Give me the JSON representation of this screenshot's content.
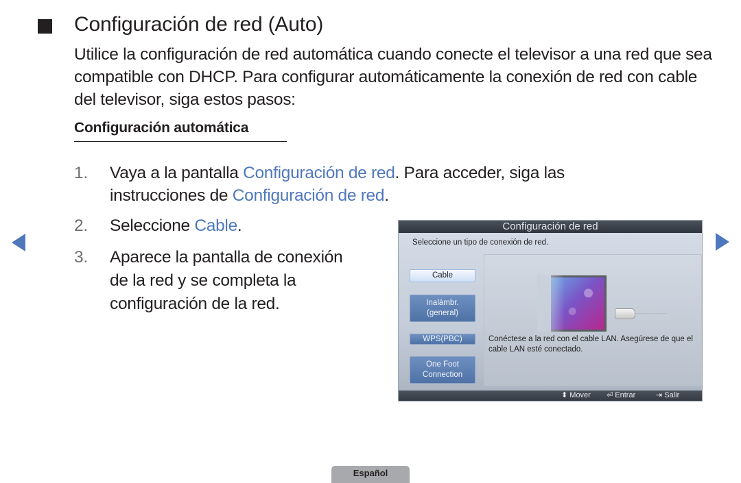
{
  "page": {
    "title": "Configuración de red (Auto)",
    "intro": "Utilice la configuración de red automática cuando conecte el televisor a una red que sea compatible con DHCP. Para configurar automáticamente la conexión de red con cable del televisor, siga estos pasos:",
    "subheading": "Configuración automática",
    "accent_color": "#4f78bc"
  },
  "steps": [
    {
      "number": "1.",
      "line1": {
        "pre": "Vaya a la pantalla ",
        "link": "Configuración de red",
        "post": ". Para acceder, siga las"
      },
      "line2": {
        "pre": "instrucciones de ",
        "link": "Configuración de red",
        "post": "."
      }
    },
    {
      "number": "2.",
      "line1": {
        "pre": "Seleccione ",
        "link": "Cable",
        "post": "."
      }
    },
    {
      "number": "3.",
      "lines": [
        "Aparece la pantalla de conexión",
        "de la red y se completa la",
        "configuración de la red."
      ]
    }
  ],
  "nav": {
    "prev_icon": "triangle-left",
    "next_icon": "triangle-right"
  },
  "tv_dialog": {
    "title": "Configuración de red",
    "prompt": "Seleccione un tipo de conexión de red.",
    "options": [
      {
        "label_lines": [
          "Cable"
        ],
        "selected": true
      },
      {
        "label_lines": [
          "Inalámbr.",
          "(general)"
        ],
        "selected": false
      },
      {
        "label_lines": [
          "WPS(PBC)"
        ],
        "selected": false
      },
      {
        "label_lines": [
          "One Foot",
          "Connection"
        ],
        "selected": false
      }
    ],
    "description": "Conéctese a la red con el cable LAN. Asegúrese de que el cable LAN esté conectado.",
    "footer": {
      "move": {
        "icon": "⬍",
        "label": "Mover"
      },
      "enter": {
        "icon": "⏎",
        "label": "Entrar"
      },
      "exit": {
        "icon": "⇥",
        "label": "Salir"
      }
    }
  },
  "language_tab": "Español"
}
